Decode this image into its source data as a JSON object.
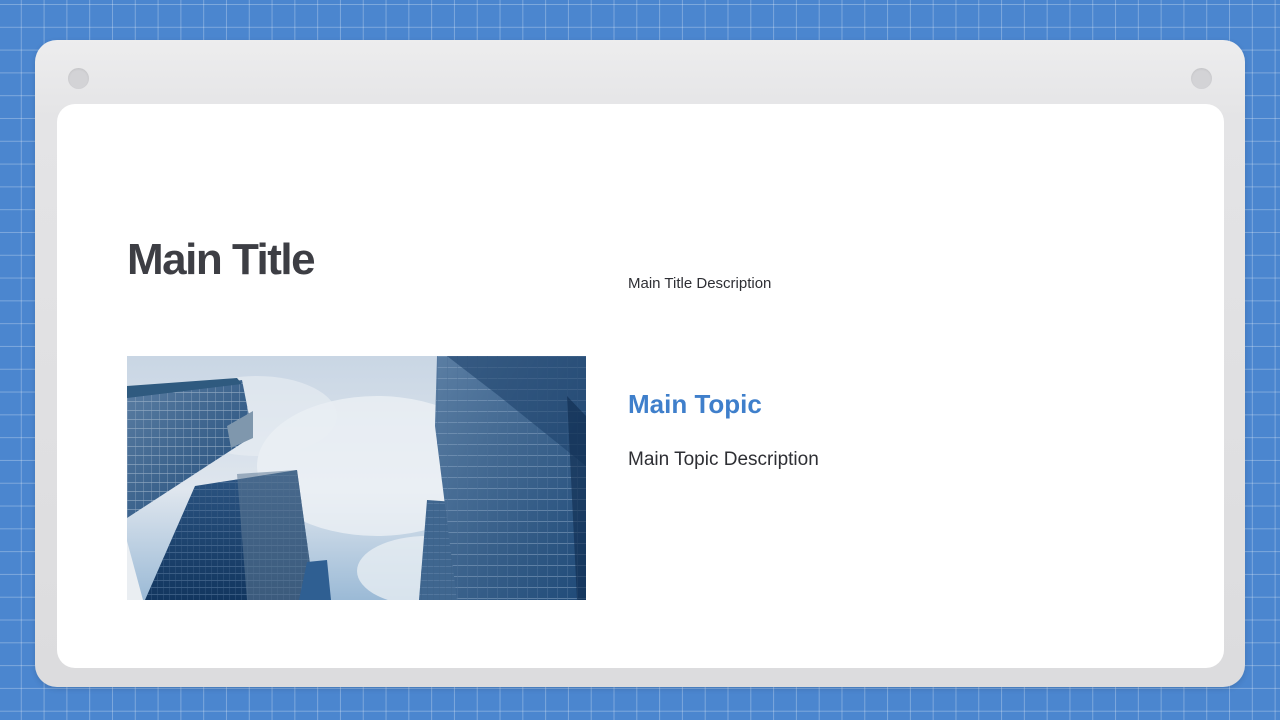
{
  "slide": {
    "title": "Main Title",
    "title_description": "Main Title Description",
    "topic": "Main Topic",
    "topic_description": "Main Topic Description"
  },
  "image": {
    "subject": "low-angle view of glass skyscrapers against a cloudy blue sky"
  },
  "colors": {
    "background": "#4b86cf",
    "grid_lines": "#ffffff",
    "frame": "#e4e4e6",
    "card": "#ffffff",
    "title_text": "#3d3e44",
    "accent": "#3f7fcb",
    "body_text": "#2e2f34"
  }
}
